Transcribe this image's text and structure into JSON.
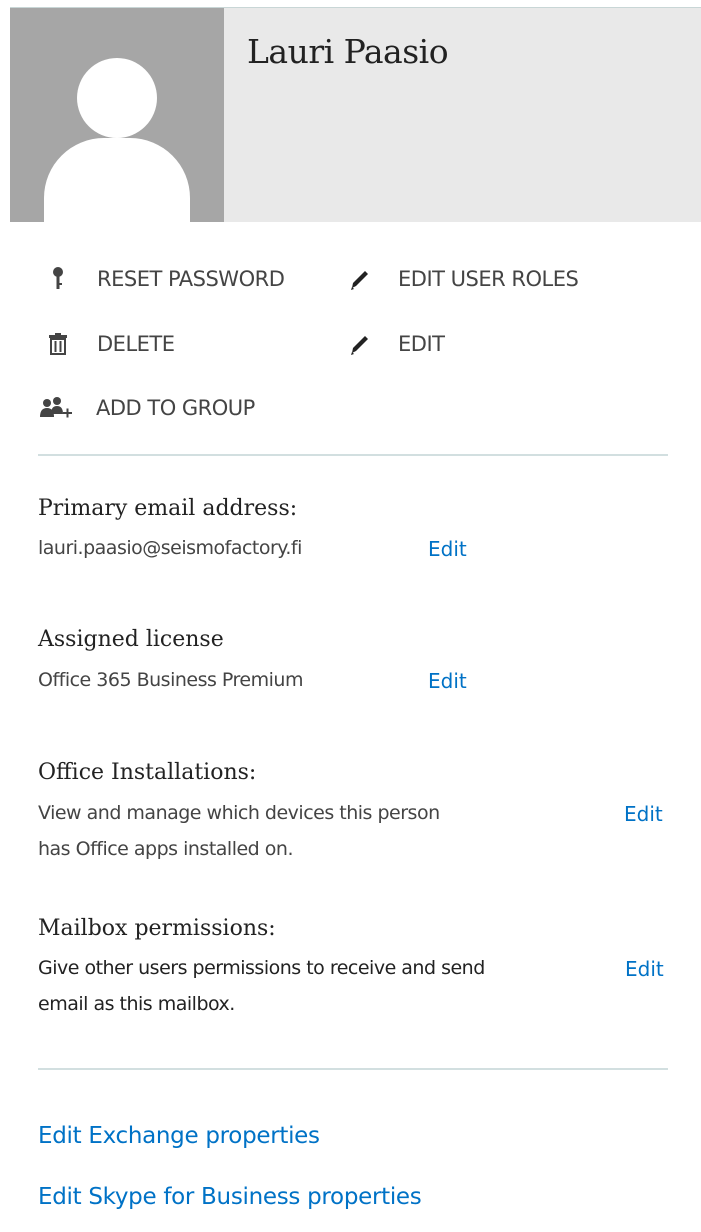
{
  "user": {
    "name": "Lauri Paasio",
    "avatar_icon": "default-avatar-icon"
  },
  "actions": {
    "reset_password": "RESET PASSWORD",
    "edit_user_roles": "EDIT USER ROLES",
    "delete": "DELETE",
    "edit": "EDIT",
    "add_to_group": "ADD TO GROUP"
  },
  "sections": {
    "primary_email": {
      "title": "Primary email address:",
      "value": "lauri.paasio@seismofactory.fi",
      "edit": "Edit"
    },
    "license": {
      "title": "Assigned license",
      "value": "Office 365 Business Premium",
      "edit": "Edit"
    },
    "office_installations": {
      "title": "Office Installations:",
      "line1": "View and manage which devices this person",
      "line2": "has Office apps installed on.",
      "edit": "Edit"
    },
    "mailbox_permissions": {
      "title": "Mailbox permissions:",
      "line1": "Give other users permissions to receive and send",
      "line2": "email as this mailbox.",
      "edit": "Edit"
    }
  },
  "links": {
    "exchange": "Edit Exchange properties",
    "skype": "Edit Skype for Business properties"
  },
  "colors": {
    "link": "#0072c6",
    "header_bg": "#e9e9e9",
    "avatar_bg": "#a6a6a6",
    "divider": "#d2dfe0"
  }
}
